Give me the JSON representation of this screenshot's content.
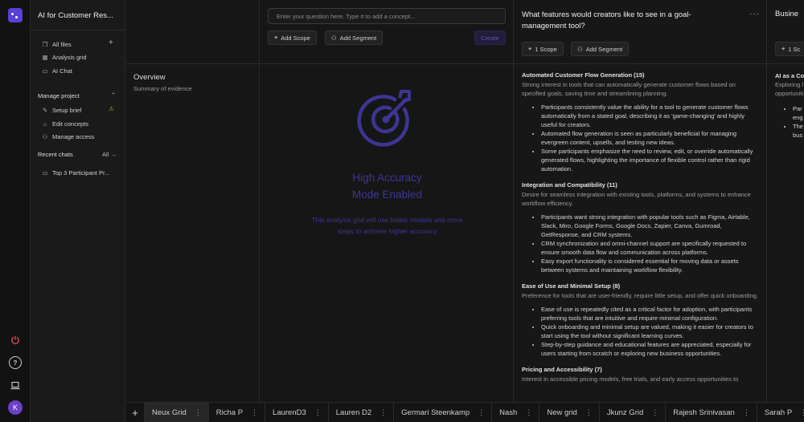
{
  "project": {
    "title": "AI for Customer Res..."
  },
  "sidebar": {
    "nav": [
      {
        "label": "All files",
        "icon": "files-icon"
      },
      {
        "label": "Analysis grid",
        "icon": "grid-icon"
      },
      {
        "label": "AI Chat",
        "icon": "chat-icon"
      }
    ],
    "manage_heading": "Manage project",
    "manage": [
      {
        "label": "Setup brief",
        "icon": "brief-icon"
      },
      {
        "label": "Edit concepts",
        "icon": "lightbulb-icon"
      },
      {
        "label": "Manage access",
        "icon": "access-icon"
      }
    ],
    "recent_heading": "Recent chats",
    "recent_all": "All",
    "recent": [
      {
        "label": "Top 3 Participant Pr..."
      }
    ]
  },
  "rail": {
    "avatar_letter": "K"
  },
  "overview": {
    "title": "Overview",
    "subtitle": "Summary of evidence"
  },
  "query": {
    "placeholder": "Enter your question here. Type # to add a concept...",
    "add_scope": "Add Scope",
    "add_segment": "Add Segment",
    "create": "Create"
  },
  "hero": {
    "title_line1": "High Accuracy",
    "title_line2": "Mode Enabled",
    "text": "This analysis grid will use better models and more steps to achieve higher accuracy"
  },
  "question1": {
    "title": "What features would creators like to see in a goal-management tool?",
    "scope": "1 Scope",
    "add_segment": "Add Segment",
    "sections": [
      {
        "heading": "Automated Customer Flow Generation (15)",
        "desc": "Strong interest in tools that can automatically generate customer flows based on specified goals, saving time and streamlining planning.",
        "bullets": [
          "Participants consistently value the ability for a tool to generate customer flows automatically from a stated goal, describing it as 'game-changing' and highly useful for creators.",
          "Automated flow generation is seen as particularly beneficial for managing evergreen content, upsells, and testing new ideas.",
          "Some participants emphasize the need to review, edit, or override automatically generated flows, highlighting the importance of flexible control rather than rigid automation."
        ]
      },
      {
        "heading": "Integration and Compatibility (11)",
        "desc": "Desire for seamless integration with existing tools, platforms, and systems to enhance workflow efficiency.",
        "bullets": [
          "Participants want strong integration with popular tools such as Figma, Airtable, Slack, Miro, Google Forms, Google Docs, Zapier, Canva, Gumroad, GetResponse, and CRM systems.",
          "CRM synchronization and omni-channel support are specifically requested to ensure smooth data flow and communication across platforms.",
          "Easy export functionality is considered essential for moving data or assets between systems and maintaining workflow flexibility."
        ]
      },
      {
        "heading": "Ease of Use and Minimal Setup (8)",
        "desc": "Preference for tools that are user-friendly, require little setup, and offer quick onboarding.",
        "bullets": [
          "Ease of use is repeatedly cited as a critical factor for adoption, with participants preferring tools that are intuitive and require minimal configuration.",
          "Quick onboarding and minimal setup are valued, making it easier for creators to start using the tool without significant learning curves.",
          "Step-by-step guidance and educational features are appreciated, especially for users starting from scratch or exploring new business opportunities."
        ]
      },
      {
        "heading": "Pricing and Accessibility (7)",
        "desc": "Interest in accessible pricing models, free trials, and early access opportunities to",
        "bullets": []
      }
    ]
  },
  "question2": {
    "title": "Busine",
    "scope": "1 Sc",
    "section_heading": "AI as a Co",
    "desc_lines": [
      "Exploring l",
      "opportuniti"
    ],
    "bullets": [
      "Par",
      "eng",
      "The",
      "bus"
    ]
  },
  "tabs": [
    {
      "label": "Neux Grid",
      "active": true
    },
    {
      "label": "Richa P"
    },
    {
      "label": "LaurenD3"
    },
    {
      "label": "Lauren D2"
    },
    {
      "label": "Germari Steenkamp"
    },
    {
      "label": "Nash"
    },
    {
      "label": "New grid"
    },
    {
      "label": "Jkunz Grid"
    },
    {
      "label": "Rajesh Srinivasan"
    },
    {
      "label": "Sarah P"
    }
  ],
  "colors": {
    "accent": "#5b3fd6",
    "hero": "#3d3594",
    "warning": "#e0a31e"
  }
}
